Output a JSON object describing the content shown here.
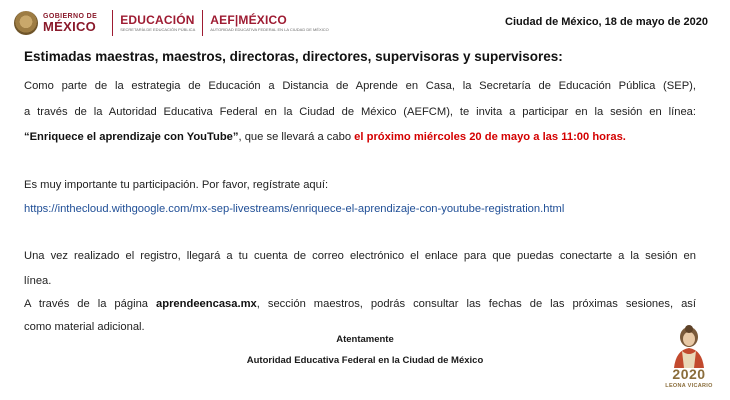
{
  "header": {
    "gob_line1": "GOBIERNO DE",
    "gob_line2": "MÉXICO",
    "edu_line1": "EDUCACIÓN",
    "edu_line2": "SECRETARÍA DE EDUCACIÓN PÚBLICA",
    "aef_line1": "AEF|MÉXICO",
    "aef_line2": "AUTORIDAD EDUCATIVA FEDERAL EN LA CIUDAD DE MÉXICO",
    "date": "Ciudad de México, 18 de mayo de 2020"
  },
  "greeting": "Estimadas maestras, maestros, directoras, directores, supervisoras y supervisores:",
  "intro": {
    "line1": "Como parte de la estrategia de Educación a Distancia de Aprende en Casa, la Secretaría de Educación Pública (SEP),",
    "line2": "a través de la Autoridad Educativa Federal en la Ciudad de México (AEFCM), te invita a participar en la sesión en línea:",
    "session_title": "“Enriquece el aprendizaje con YouTube”",
    "line3_mid": ", que se llevará a cabo ",
    "session_date": "el próximo miércoles 20 de mayo a las 11:00 horas."
  },
  "register": {
    "prompt": "Es muy importante tu participación. Por favor, regístrate aquí:",
    "url": "https://inthecloud.withgoogle.com/mx-sep-livestreams/enriquece-el-aprendizaje-con-youtube-registration.html"
  },
  "followup": {
    "line1": "Una vez realizado el registro, llegará a tu cuenta de correo electrónico el enlace para que puedas conectarte a la sesión en",
    "line2": "línea.",
    "line3_pre": "A través de la página ",
    "site": "aprendeencasa.mx",
    "line3_post": ", sección maestros, podrás consultar las fechas de las próximas sesiones, así",
    "line4": "como material adicional."
  },
  "closing": {
    "regards": "Atentamente",
    "signature": "Autoridad Educativa Federal en la Ciudad de México"
  },
  "badge": {
    "year": "2020",
    "name": "LEONA VICARIO"
  }
}
